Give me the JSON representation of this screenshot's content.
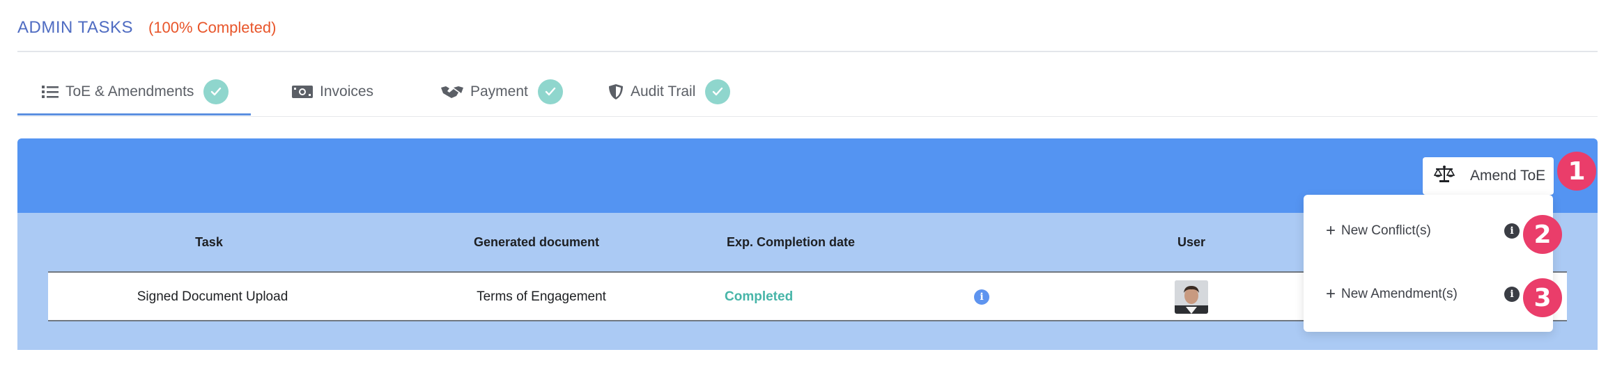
{
  "header": {
    "title": "ADMIN TASKS",
    "progress": "(100% Completed)"
  },
  "tabs": [
    {
      "label": "ToE & Amendments",
      "icon": "list-icon",
      "completed": true,
      "active": true
    },
    {
      "label": "Invoices",
      "icon": "money-bill-icon",
      "completed": false,
      "active": false
    },
    {
      "label": "Payment",
      "icon": "handshake-icon",
      "completed": true,
      "active": false
    },
    {
      "label": "Audit Trail",
      "icon": "shield-icon",
      "completed": true,
      "active": false
    }
  ],
  "panel": {
    "amend_button_label": "Amend ToE"
  },
  "table": {
    "columns": [
      "Task",
      "Generated document",
      "Exp. Completion date",
      "User"
    ],
    "rows": [
      {
        "task": "Signed Document Upload",
        "document": "Terms of Engagement",
        "status": "Completed"
      }
    ]
  },
  "dropdown": {
    "items": [
      {
        "label": "New Conflict(s)"
      },
      {
        "label": "New Amendment(s)"
      }
    ]
  },
  "markers": [
    "1",
    "2",
    "3"
  ],
  "colors": {
    "accent_blue": "#5494f2",
    "panel_light_blue": "#abcaf4",
    "title_blue": "#4f6cc2",
    "progress_orange": "#e8552a",
    "check_teal": "#8fd6cd",
    "completed_teal": "#47b5a8",
    "marker_pink": "#ea3d6a"
  }
}
